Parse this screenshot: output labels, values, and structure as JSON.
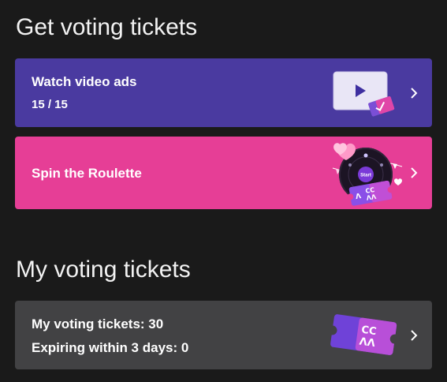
{
  "get_section": {
    "title": "Get voting tickets"
  },
  "video_ads": {
    "label": "Watch video ads",
    "progress": "15 / 15",
    "color": "#4a3aa0"
  },
  "roulette": {
    "label": "Spin the Roulette",
    "wheel_start_label": "Start",
    "color": "#e63e96"
  },
  "my_section": {
    "title": "My voting tickets"
  },
  "my_tickets": {
    "count_line": "My voting tickets: 30",
    "expiring_line": "Expiring within 3 days: 0",
    "color": "#424244"
  },
  "ticket_brand_text": "CC\nɅɅ"
}
